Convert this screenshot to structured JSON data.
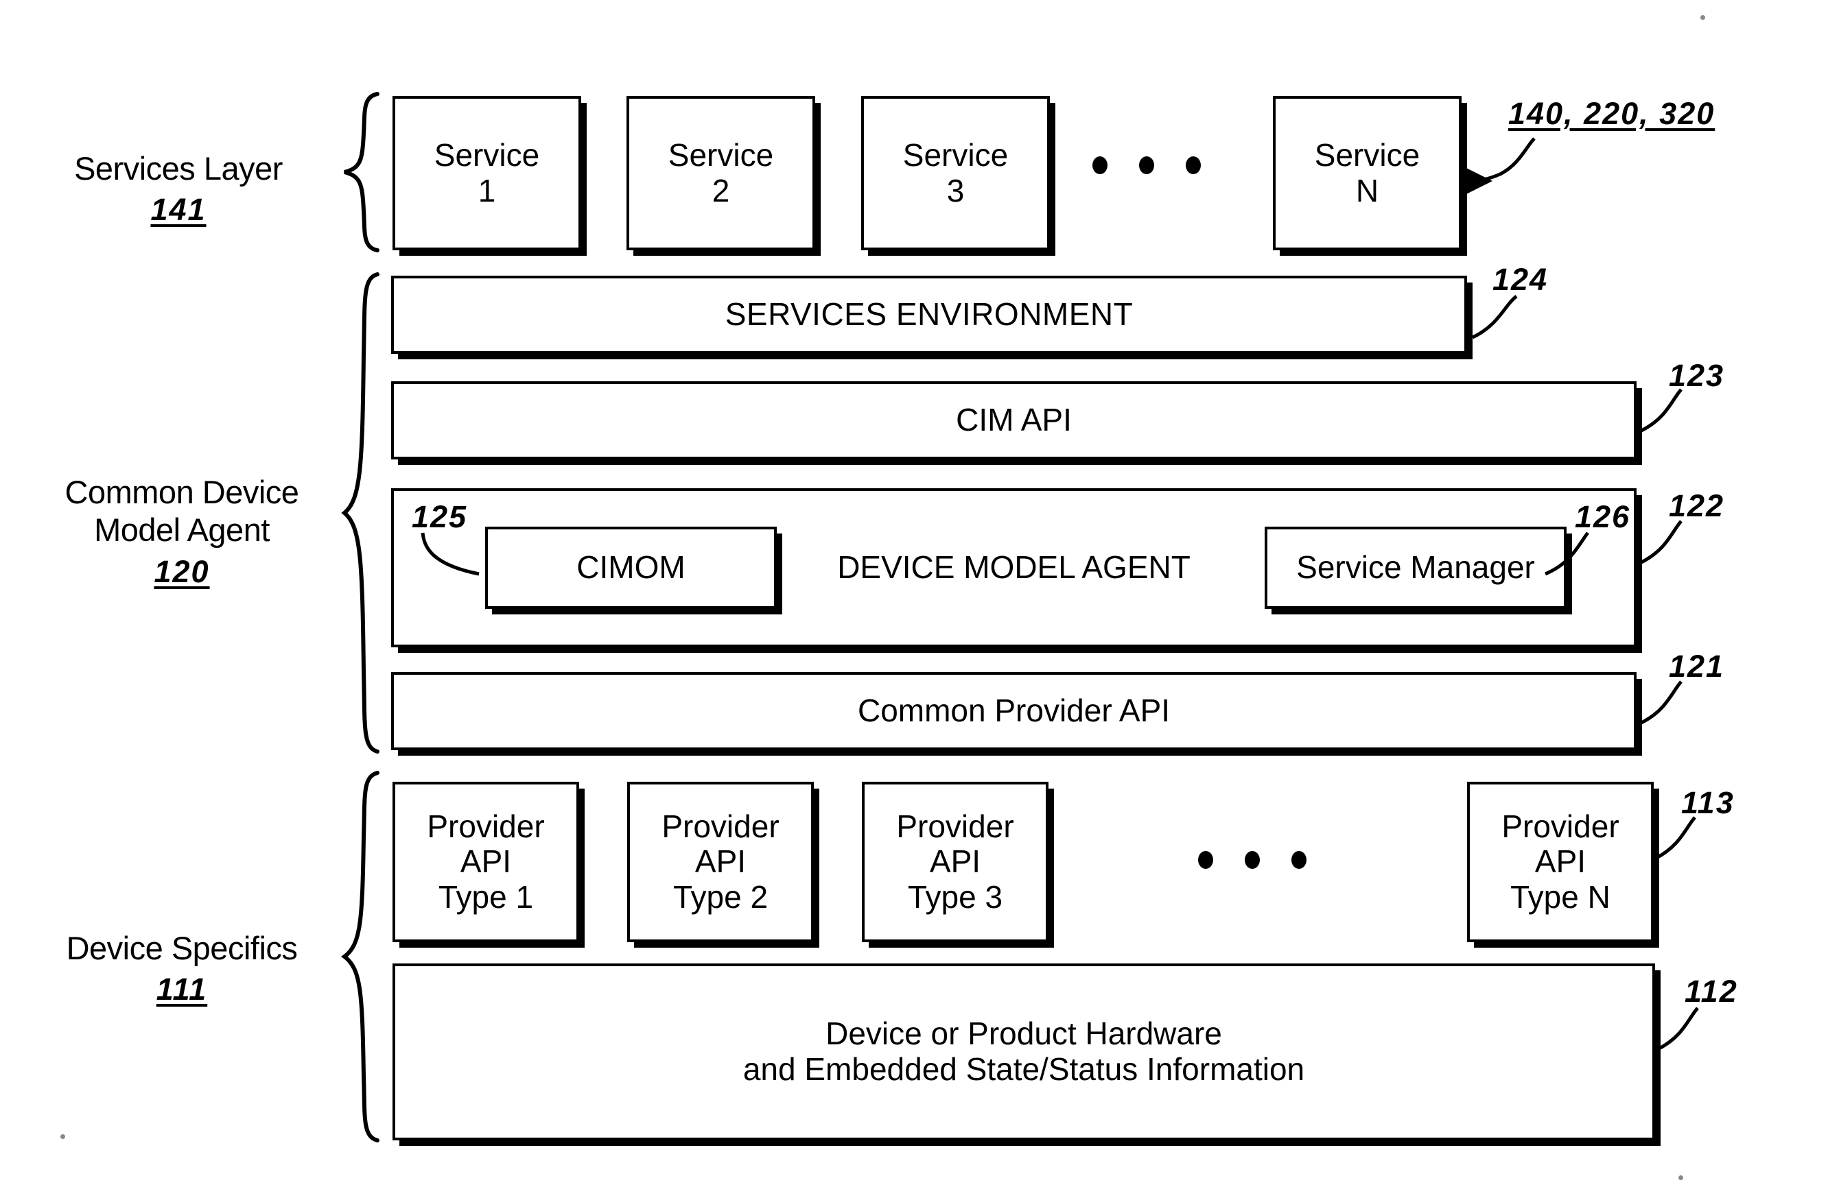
{
  "figure": {
    "title": "Common Device Model Agent architecture layer diagram",
    "background_color": "#ffffff",
    "line_color": "#000000"
  },
  "groups": [
    {
      "id": "services-layer",
      "label_line1": "Services Layer",
      "ref": "141"
    },
    {
      "id": "common-device-model-agent",
      "label_line1": "Common Device",
      "label_line2": "Model Agent",
      "ref": "120"
    },
    {
      "id": "device-specifics",
      "label_line1": "Device Specifics",
      "ref": "111"
    }
  ],
  "services_layer": {
    "boxes": [
      {
        "line1": "Service",
        "line2": "1"
      },
      {
        "line1": "Service",
        "line2": "2"
      },
      {
        "line1": "Service",
        "line2": "3"
      },
      {
        "line1": "Service",
        "line2": "N"
      }
    ],
    "ellipsis": "• • •",
    "callout": "140, 220, 320"
  },
  "agent_layer": {
    "services_environment": {
      "label": "SERVICES ENVIRONMENT",
      "ref": "124"
    },
    "cim_api": {
      "label": "CIM API",
      "ref": "123"
    },
    "device_model_agent": {
      "label": "DEVICE MODEL AGENT",
      "ref": "122",
      "cimom": {
        "label": "CIMOM",
        "ref": "125"
      },
      "service_manager": {
        "label": "Service Manager",
        "ref": "126"
      }
    },
    "common_provider_api": {
      "label": "Common Provider API",
      "ref": "121"
    }
  },
  "device_specifics_layer": {
    "provider_boxes": [
      {
        "line1": "Provider",
        "line2": "API",
        "line3": "Type 1"
      },
      {
        "line1": "Provider",
        "line2": "API",
        "line3": "Type 2"
      },
      {
        "line1": "Provider",
        "line2": "API",
        "line3": "Type 3"
      },
      {
        "line1": "Provider",
        "line2": "API",
        "line3": "Type N"
      }
    ],
    "provider_ref": "113",
    "ellipsis": "• • •",
    "hardware": {
      "line1": "Device or Product Hardware",
      "line2": "and Embedded State/Status Information",
      "ref": "112"
    }
  }
}
